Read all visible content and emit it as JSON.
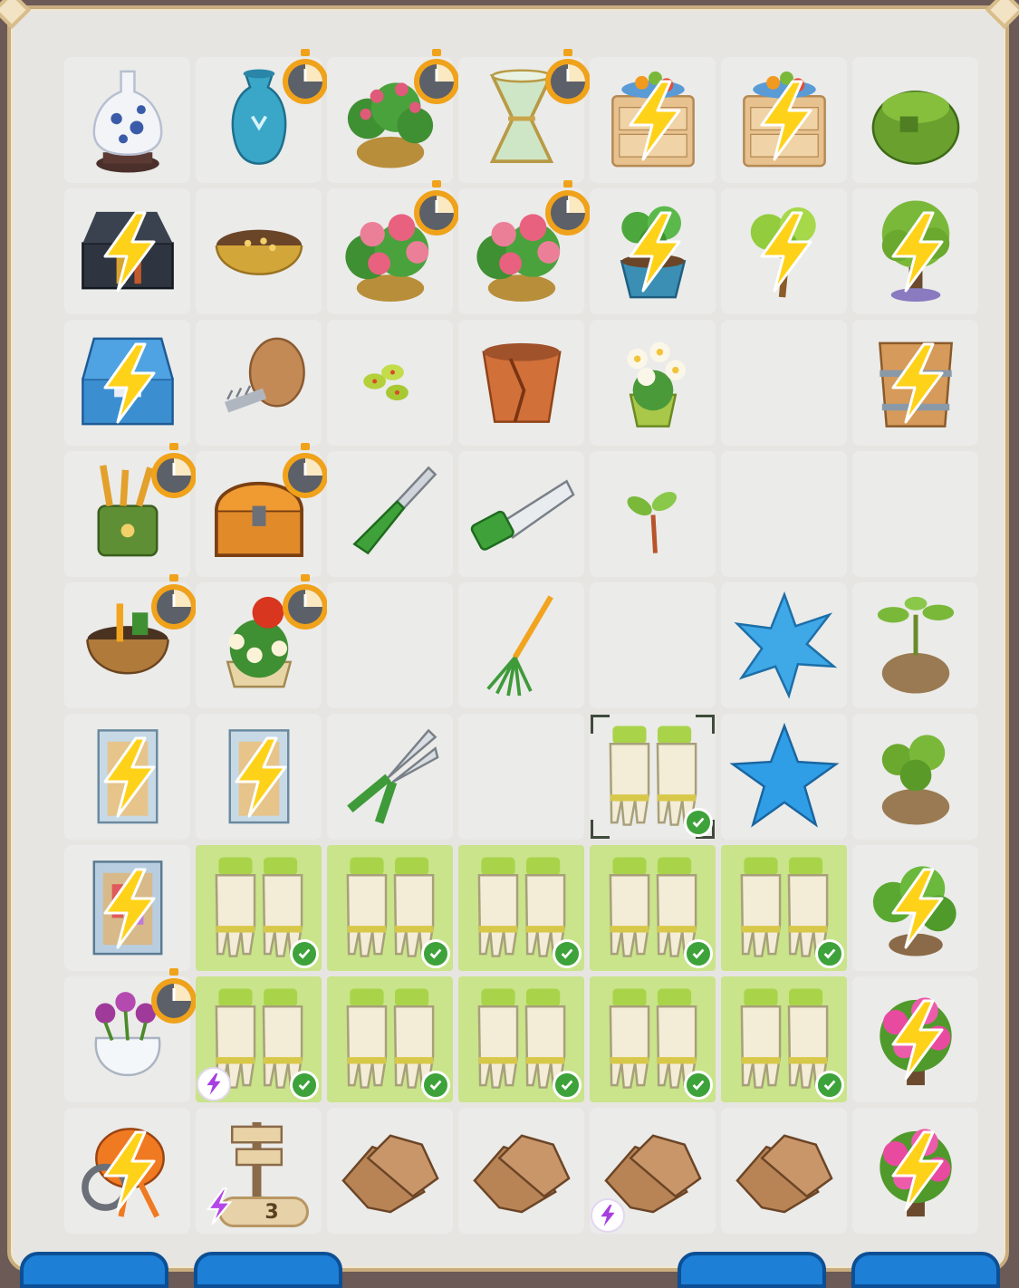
{
  "board": {
    "rows": 9,
    "cols": 7,
    "cells": [
      [
        {
          "item": "porcelain-vase"
        },
        {
          "item": "turquoise-vase",
          "timer": true
        },
        {
          "item": "peony-bush",
          "timer": true
        },
        {
          "item": "glass-vase",
          "timer": true
        },
        {
          "item": "nightstand-fruit",
          "bolt": true
        },
        {
          "item": "nightstand-fruit",
          "bolt": true
        },
        {
          "item": "green-bag"
        }
      ],
      [
        {
          "item": "toolbox-dark",
          "bolt": true
        },
        {
          "item": "seed-bowl"
        },
        {
          "item": "peony-pot",
          "timer": true
        },
        {
          "item": "peony-pot",
          "timer": true
        },
        {
          "item": "sapling-pot",
          "bolt": true
        },
        {
          "item": "young-tree",
          "bolt": true
        },
        {
          "item": "tree",
          "bolt": true
        }
      ],
      [
        {
          "item": "toolbox-blue",
          "bolt": true
        },
        {
          "item": "wooden-screw"
        },
        {
          "item": "seeds"
        },
        {
          "item": "broken-pot"
        },
        {
          "item": "white-flower-pot"
        },
        {
          "item": "empty"
        },
        {
          "item": "wooden-bucket",
          "bolt": true
        }
      ],
      [
        {
          "item": "tool-caddy",
          "timer": true
        },
        {
          "item": "treasure-chest",
          "timer": true
        },
        {
          "item": "garden-knife"
        },
        {
          "item": "hand-saw"
        },
        {
          "item": "sprout"
        },
        {
          "item": "empty"
        },
        {
          "item": "empty"
        }
      ],
      [
        {
          "item": "tool-tub",
          "timer": true
        },
        {
          "item": "flower-planter",
          "timer": true
        },
        {
          "item": "empty"
        },
        {
          "item": "rake"
        },
        {
          "item": "empty"
        },
        {
          "item": "blue-splat"
        },
        {
          "item": "plant-sack"
        }
      ],
      [
        {
          "item": "cabinet",
          "bolt": true
        },
        {
          "item": "cabinet",
          "bolt": true
        },
        {
          "item": "pruning-shears"
        },
        {
          "item": "empty"
        },
        {
          "item": "garden-gloves",
          "selected": true,
          "check": true
        },
        {
          "item": "blue-star"
        },
        {
          "item": "plant-sack-2"
        }
      ],
      [
        {
          "item": "cabinet-open",
          "bolt": true
        },
        {
          "item": "garden-gloves",
          "hl": true,
          "check": true
        },
        {
          "item": "garden-gloves",
          "hl": true,
          "check": true
        },
        {
          "item": "garden-gloves",
          "hl": true,
          "check": true
        },
        {
          "item": "garden-gloves",
          "hl": true,
          "check": true
        },
        {
          "item": "garden-gloves",
          "hl": true,
          "check": true
        },
        {
          "item": "bush",
          "bolt": true
        }
      ],
      [
        {
          "item": "tulip-vase",
          "timer": true
        },
        {
          "item": "garden-gloves",
          "hl": true,
          "check": true,
          "energy": true
        },
        {
          "item": "garden-gloves",
          "hl": true,
          "check": true
        },
        {
          "item": "garden-gloves",
          "hl": true,
          "check": true
        },
        {
          "item": "garden-gloves",
          "hl": true,
          "check": true
        },
        {
          "item": "garden-gloves",
          "hl": true,
          "check": true
        },
        {
          "item": "hydrangea",
          "bolt": true
        }
      ],
      [
        {
          "item": "cement-mixer",
          "bolt": true
        },
        {
          "item": "signpost",
          "counter": "3"
        },
        {
          "item": "leather-gloves"
        },
        {
          "item": "leather-gloves"
        },
        {
          "item": "leather-gloves",
          "energy": true
        },
        {
          "item": "leather-gloves"
        },
        {
          "item": "hydrangea",
          "bolt": true
        }
      ]
    ]
  },
  "colors": {
    "bolt": "#ffd21a",
    "check": "#3ea23a",
    "highlight": "#c9e48a",
    "energy": "#a63ee0",
    "button": "#1e7fd6"
  }
}
